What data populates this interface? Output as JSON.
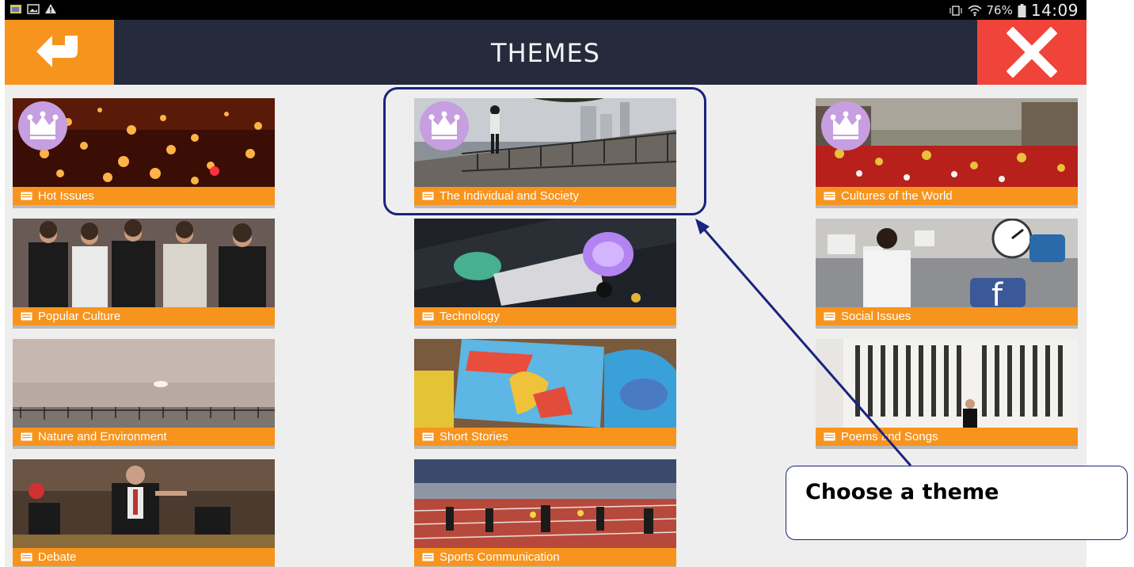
{
  "status_bar": {
    "battery_percent": "76%",
    "time": "14:09"
  },
  "header": {
    "title": "THEMES",
    "back_icon": "back-arrow-icon",
    "close_icon": "close-icon",
    "back_color": "#f7941d",
    "close_color": "#f0433a",
    "bar_color": "#262a3d"
  },
  "themes": [
    {
      "label": "Hot Issues",
      "premium": true
    },
    {
      "label": "The Individual and Society",
      "premium": true
    },
    {
      "label": "Cultures of the World",
      "premium": true
    },
    {
      "label": "Popular Culture",
      "premium": false
    },
    {
      "label": "Technology",
      "premium": false
    },
    {
      "label": "Social Issues",
      "premium": false
    },
    {
      "label": "Nature and Environment",
      "premium": false
    },
    {
      "label": "Short Stories",
      "premium": false
    },
    {
      "label": "Poems and Songs",
      "premium": false
    },
    {
      "label": "Debate",
      "premium": false
    },
    {
      "label": "Sports Communication",
      "premium": false
    }
  ],
  "annotation": {
    "callout_text": "Choose a theme",
    "highlighted_theme": "The Individual and Society"
  }
}
